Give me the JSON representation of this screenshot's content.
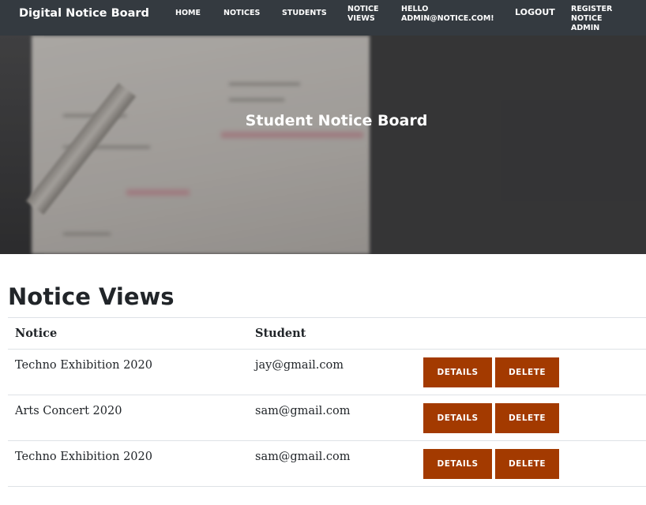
{
  "navbar": {
    "brand": "Digital Notice Board",
    "items": [
      {
        "label": "HOME"
      },
      {
        "label": "NOTICES"
      },
      {
        "label": "STUDENTS"
      },
      {
        "label": "NOTICE\nVIEWS"
      },
      {
        "label": "HELLO\nADMIN@NOTICE.COM!"
      },
      {
        "label": "LOGOUT"
      },
      {
        "label": "REGISTER NOTICE\nADMIN"
      }
    ]
  },
  "hero": {
    "title": "Student Notice Board"
  },
  "main": {
    "title": "Notice Views",
    "table": {
      "headers": [
        "Notice",
        "Student",
        ""
      ],
      "rows": [
        {
          "notice": "Techno Exhibition 2020",
          "student": "jay@gmail.com",
          "details_label": "DETAILS",
          "delete_label": "DELETE"
        },
        {
          "notice": "Arts Concert 2020",
          "student": "sam@gmail.com",
          "details_label": "DETAILS",
          "delete_label": "DELETE"
        },
        {
          "notice": "Techno Exhibition 2020",
          "student": "sam@gmail.com",
          "details_label": "DETAILS",
          "delete_label": "DELETE"
        }
      ]
    }
  },
  "colors": {
    "navbar_bg": "#343a40",
    "button_bg": "#a33a00",
    "button_text": "#ffffff",
    "heading_text": "#212529"
  }
}
